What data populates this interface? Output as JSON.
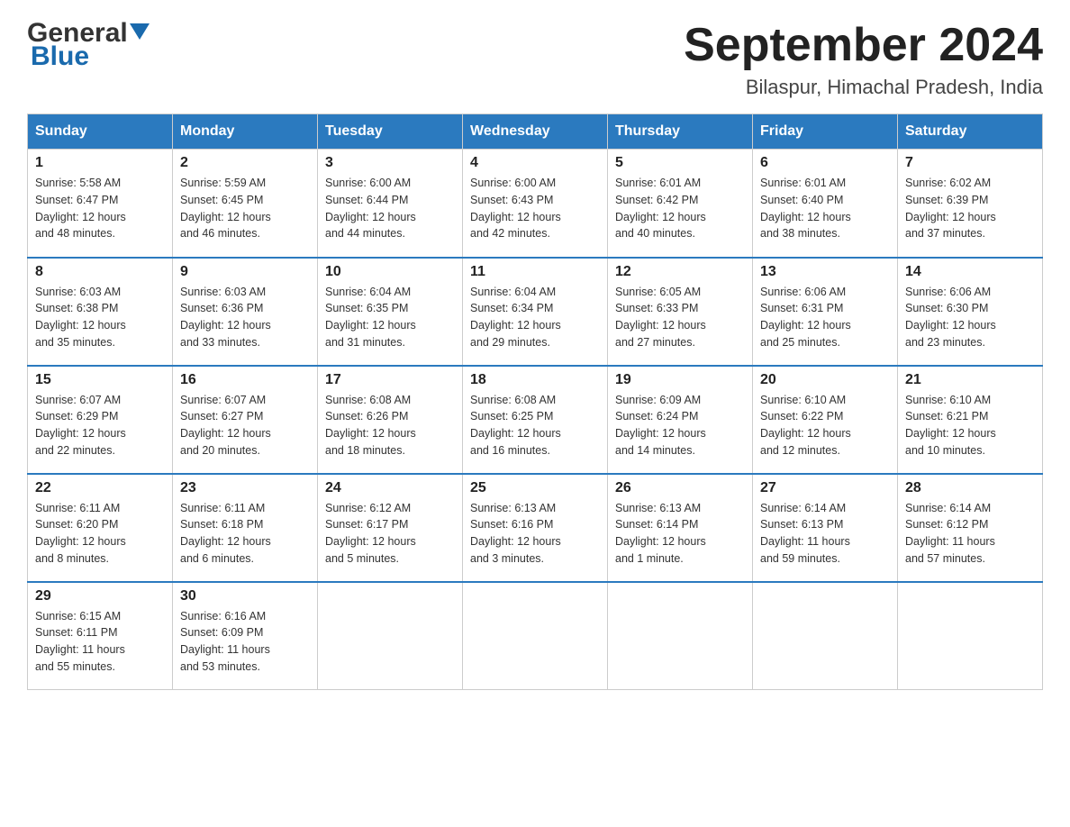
{
  "header": {
    "logo_general": "General",
    "logo_blue": "Blue",
    "month_title": "September 2024",
    "location": "Bilaspur, Himachal Pradesh, India"
  },
  "weekdays": [
    "Sunday",
    "Monday",
    "Tuesday",
    "Wednesday",
    "Thursday",
    "Friday",
    "Saturday"
  ],
  "weeks": [
    [
      {
        "day": "1",
        "sunrise": "5:58 AM",
        "sunset": "6:47 PM",
        "daylight": "12 hours and 48 minutes."
      },
      {
        "day": "2",
        "sunrise": "5:59 AM",
        "sunset": "6:45 PM",
        "daylight": "12 hours and 46 minutes."
      },
      {
        "day": "3",
        "sunrise": "6:00 AM",
        "sunset": "6:44 PM",
        "daylight": "12 hours and 44 minutes."
      },
      {
        "day": "4",
        "sunrise": "6:00 AM",
        "sunset": "6:43 PM",
        "daylight": "12 hours and 42 minutes."
      },
      {
        "day": "5",
        "sunrise": "6:01 AM",
        "sunset": "6:42 PM",
        "daylight": "12 hours and 40 minutes."
      },
      {
        "day": "6",
        "sunrise": "6:01 AM",
        "sunset": "6:40 PM",
        "daylight": "12 hours and 38 minutes."
      },
      {
        "day": "7",
        "sunrise": "6:02 AM",
        "sunset": "6:39 PM",
        "daylight": "12 hours and 37 minutes."
      }
    ],
    [
      {
        "day": "8",
        "sunrise": "6:03 AM",
        "sunset": "6:38 PM",
        "daylight": "12 hours and 35 minutes."
      },
      {
        "day": "9",
        "sunrise": "6:03 AM",
        "sunset": "6:36 PM",
        "daylight": "12 hours and 33 minutes."
      },
      {
        "day": "10",
        "sunrise": "6:04 AM",
        "sunset": "6:35 PM",
        "daylight": "12 hours and 31 minutes."
      },
      {
        "day": "11",
        "sunrise": "6:04 AM",
        "sunset": "6:34 PM",
        "daylight": "12 hours and 29 minutes."
      },
      {
        "day": "12",
        "sunrise": "6:05 AM",
        "sunset": "6:33 PM",
        "daylight": "12 hours and 27 minutes."
      },
      {
        "day": "13",
        "sunrise": "6:06 AM",
        "sunset": "6:31 PM",
        "daylight": "12 hours and 25 minutes."
      },
      {
        "day": "14",
        "sunrise": "6:06 AM",
        "sunset": "6:30 PM",
        "daylight": "12 hours and 23 minutes."
      }
    ],
    [
      {
        "day": "15",
        "sunrise": "6:07 AM",
        "sunset": "6:29 PM",
        "daylight": "12 hours and 22 minutes."
      },
      {
        "day": "16",
        "sunrise": "6:07 AM",
        "sunset": "6:27 PM",
        "daylight": "12 hours and 20 minutes."
      },
      {
        "day": "17",
        "sunrise": "6:08 AM",
        "sunset": "6:26 PM",
        "daylight": "12 hours and 18 minutes."
      },
      {
        "day": "18",
        "sunrise": "6:08 AM",
        "sunset": "6:25 PM",
        "daylight": "12 hours and 16 minutes."
      },
      {
        "day": "19",
        "sunrise": "6:09 AM",
        "sunset": "6:24 PM",
        "daylight": "12 hours and 14 minutes."
      },
      {
        "day": "20",
        "sunrise": "6:10 AM",
        "sunset": "6:22 PM",
        "daylight": "12 hours and 12 minutes."
      },
      {
        "day": "21",
        "sunrise": "6:10 AM",
        "sunset": "6:21 PM",
        "daylight": "12 hours and 10 minutes."
      }
    ],
    [
      {
        "day": "22",
        "sunrise": "6:11 AM",
        "sunset": "6:20 PM",
        "daylight": "12 hours and 8 minutes."
      },
      {
        "day": "23",
        "sunrise": "6:11 AM",
        "sunset": "6:18 PM",
        "daylight": "12 hours and 6 minutes."
      },
      {
        "day": "24",
        "sunrise": "6:12 AM",
        "sunset": "6:17 PM",
        "daylight": "12 hours and 5 minutes."
      },
      {
        "day": "25",
        "sunrise": "6:13 AM",
        "sunset": "6:16 PM",
        "daylight": "12 hours and 3 minutes."
      },
      {
        "day": "26",
        "sunrise": "6:13 AM",
        "sunset": "6:14 PM",
        "daylight": "12 hours and 1 minute."
      },
      {
        "day": "27",
        "sunrise": "6:14 AM",
        "sunset": "6:13 PM",
        "daylight": "11 hours and 59 minutes."
      },
      {
        "day": "28",
        "sunrise": "6:14 AM",
        "sunset": "6:12 PM",
        "daylight": "11 hours and 57 minutes."
      }
    ],
    [
      {
        "day": "29",
        "sunrise": "6:15 AM",
        "sunset": "6:11 PM",
        "daylight": "11 hours and 55 minutes."
      },
      {
        "day": "30",
        "sunrise": "6:16 AM",
        "sunset": "6:09 PM",
        "daylight": "11 hours and 53 minutes."
      },
      null,
      null,
      null,
      null,
      null
    ]
  ]
}
